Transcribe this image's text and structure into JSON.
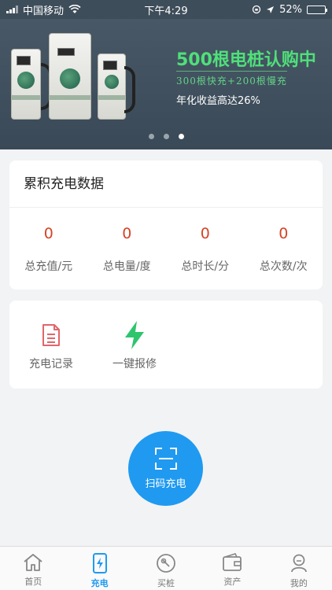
{
  "status_bar": {
    "carrier": "中国移动",
    "time": "下午4:29",
    "battery": "52%",
    "battery_level": 0.52
  },
  "banner": {
    "title": "500根电桩认购中",
    "subtitle": "300根快充+200根慢充",
    "yield_text": "年化收益高达26%",
    "slide_count": 3,
    "active_slide": 3
  },
  "stats": {
    "title": "累积充电数据",
    "items": [
      {
        "value": "0",
        "label": "总充值/元"
      },
      {
        "value": "0",
        "label": "总电量/度"
      },
      {
        "value": "0",
        "label": "总时长/分"
      },
      {
        "value": "0",
        "label": "总次数/次"
      }
    ]
  },
  "actions": [
    {
      "label": "充电记录",
      "icon": "document-icon",
      "color": "#e0666a"
    },
    {
      "label": "一键报修",
      "icon": "lightning-icon",
      "color": "#2ec56d"
    }
  ],
  "scan": {
    "label": "扫码充电",
    "icon": "scan-icon"
  },
  "tabs": [
    {
      "label": "首页",
      "icon": "home-icon",
      "active": false
    },
    {
      "label": "充电",
      "icon": "phone-charge-icon",
      "active": true
    },
    {
      "label": "买桩",
      "icon": "compass-icon",
      "active": false
    },
    {
      "label": "资产",
      "icon": "wallet-icon",
      "active": false
    },
    {
      "label": "我的",
      "icon": "user-icon",
      "active": false
    }
  ],
  "colors": {
    "accent": "#1f9af0",
    "value_red": "#d64327",
    "banner_green": "#4fe07a"
  }
}
